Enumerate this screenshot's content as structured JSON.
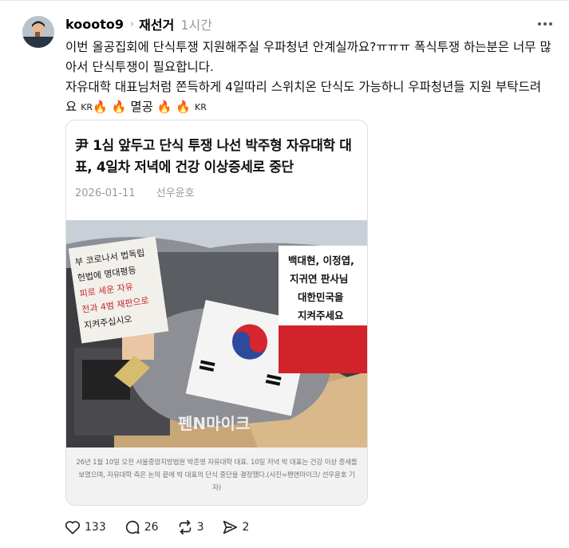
{
  "post": {
    "username": "koooto9",
    "topic": "재선거",
    "time": "1시간",
    "lines": [
      "이번 올공집회에 단식투쟁 지원해주실 우파청년 안계실까요?ㅠㅠㅠ 폭식투쟁 하는분은 너무 많아서 단식투쟁이 필요합니다.",
      "자유대학 대표님처럼 쫀득하게 4일따리 스위치온 단식도 가능하니 우파청년들 지원 부탁드려요"
    ],
    "emoji_tail": {
      "kr1": "KR",
      "word": "멸공",
      "kr2": "KR"
    }
  },
  "card": {
    "title": "尹 1심 앞두고 단식 투쟁 나선 박주형 자유대학 대표, 4일차 저녁에 건강 이상증세로 중단",
    "date": "2026-01-11",
    "author": "선우윤호",
    "photo": {
      "left_sign_lines": [
        "부 코로나서 법독립",
        "헌법에 명대평등",
        "피로 세운 자유",
        "전과 4범 재판으로",
        "지켜주십시오"
      ],
      "right_sign_lines": [
        "백대현, 이정엽,",
        "지귀연 판사님",
        "대한민국을",
        "지켜주세요"
      ],
      "watermark": "펜N마이크"
    },
    "caption": "26년 1월 10일 오전 서울중앙지방법원 박준영 자유대학 대표. 10일 저녁 박 대표는 건강 이상 증세를 보였으며, 자유대학 측은 논의 끝에 박 대표의 단식 중단을 결정했다.(사진=펜앤마이크/ 선우윤호 기자)"
  },
  "actions": {
    "likes": "133",
    "comments": "26",
    "reposts": "3",
    "shares": "2"
  },
  "colors": {
    "accent_fire": "#f25c05",
    "muted": "#999999"
  }
}
